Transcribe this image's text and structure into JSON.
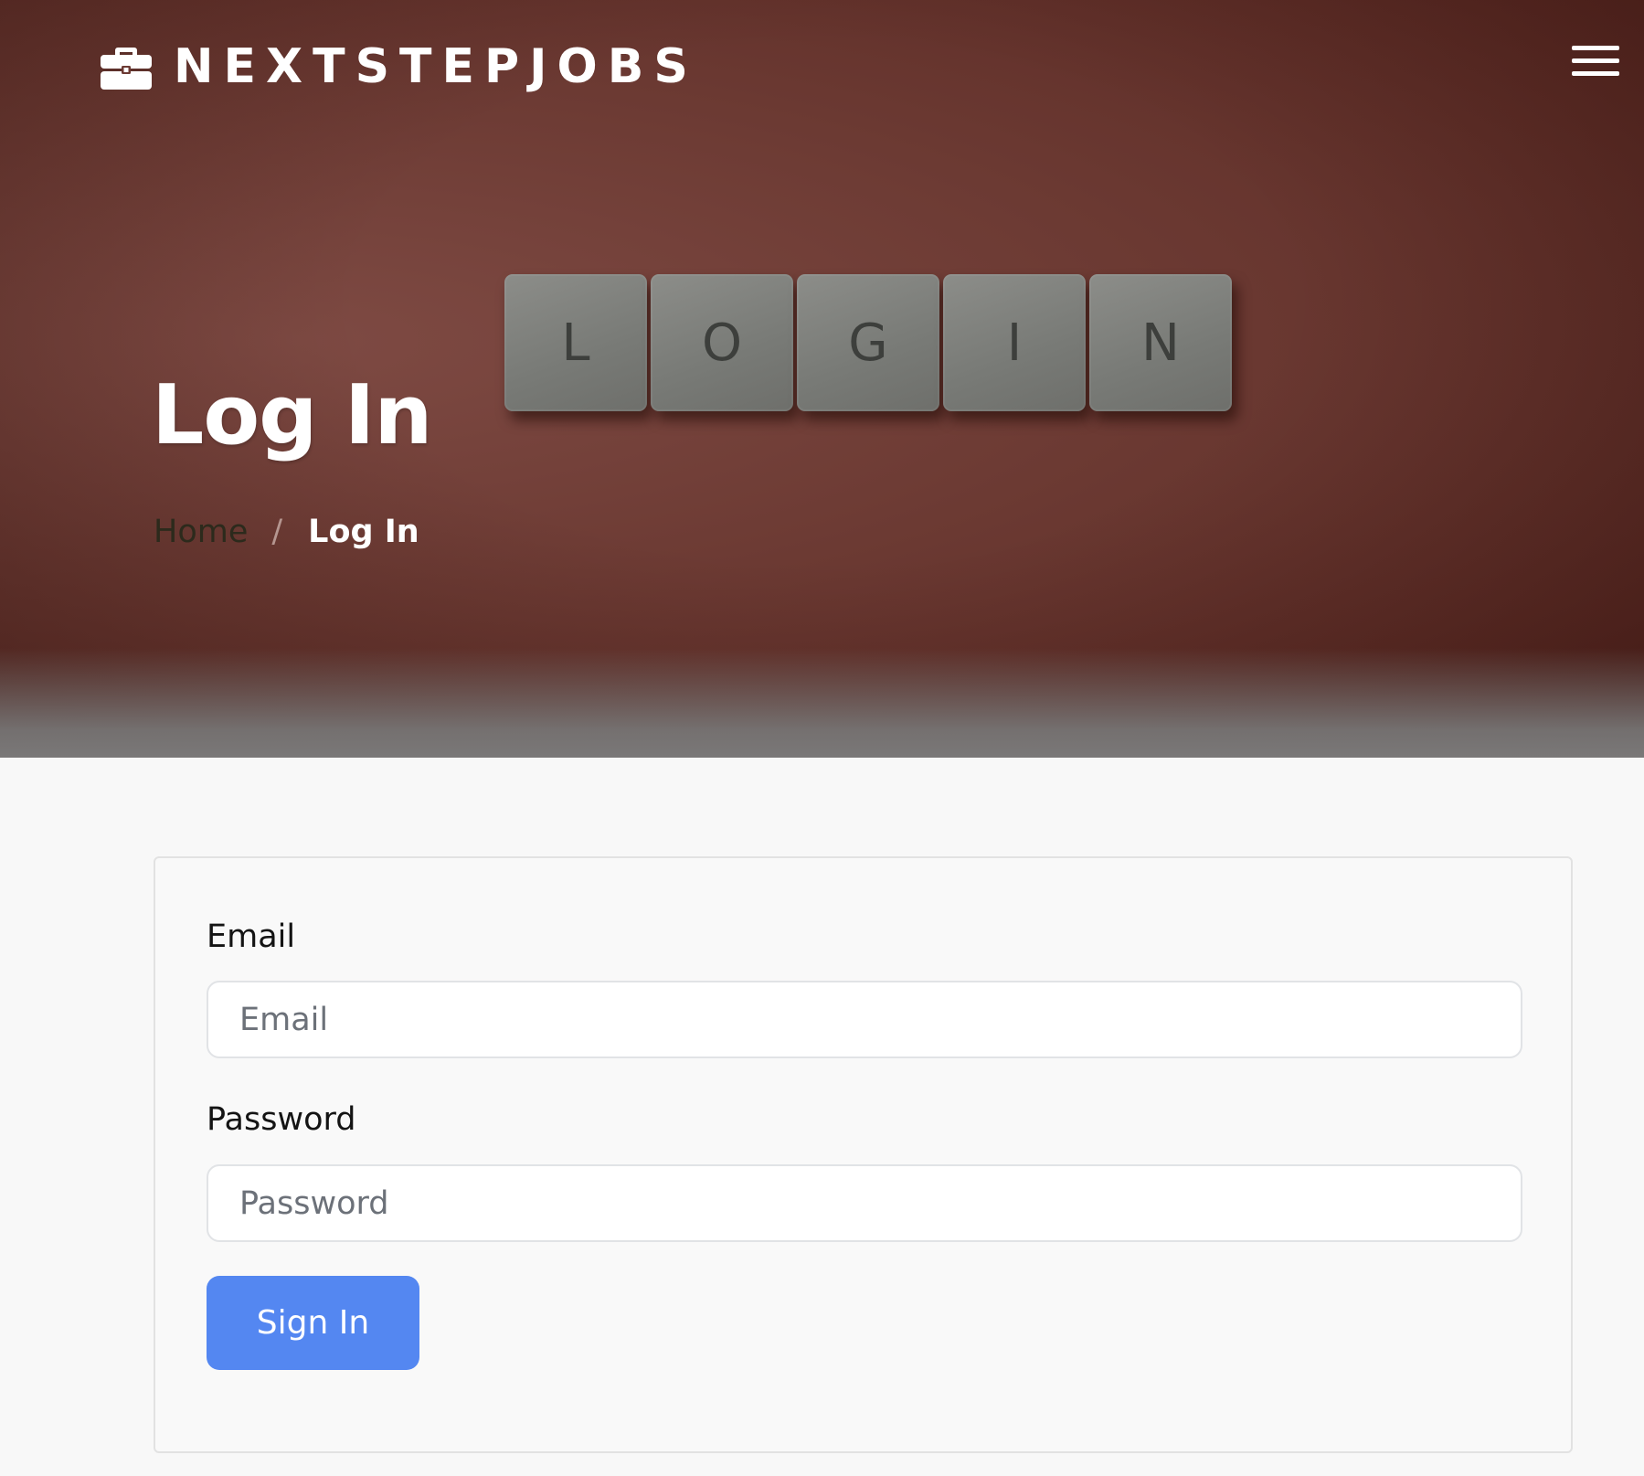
{
  "header": {
    "brand_name": "NEXTSTEPJOBS",
    "brand_icon": "briefcase-icon",
    "menu_icon": "hamburger-menu-icon"
  },
  "hero": {
    "tiles": [
      "L",
      "O",
      "G",
      "I",
      "N"
    ],
    "title": "Log In",
    "breadcrumb": {
      "home": "Home",
      "separator": "/",
      "current": "Log In"
    }
  },
  "form": {
    "email_label": "Email",
    "email_placeholder": "Email",
    "email_value": "",
    "password_label": "Password",
    "password_placeholder": "Password",
    "password_value": "",
    "submit_label": "Sign In"
  },
  "colors": {
    "hero_background": "#6c3a33",
    "button": "#5487f1",
    "page_background": "#f8f8f8"
  }
}
